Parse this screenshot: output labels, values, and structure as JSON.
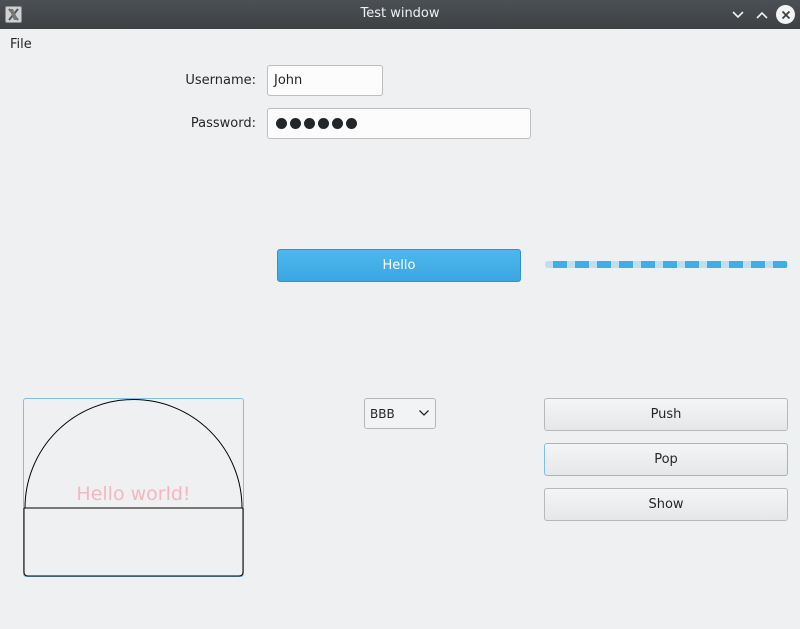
{
  "window": {
    "title": "Test window"
  },
  "menu": {
    "file": "File"
  },
  "form": {
    "username_label": "Username:",
    "username_value": "John",
    "password_label": "Password:",
    "password_mask_count": 6
  },
  "hello_button": {
    "label": "Hello"
  },
  "progress": {
    "state": "indeterminate"
  },
  "canvas": {
    "text": "Hello world!"
  },
  "combo": {
    "selected": "BBB"
  },
  "buttons": {
    "push": "Push",
    "pop": "Pop",
    "show": "Show"
  },
  "icons": {
    "app": "app-icon",
    "minimize": "chevron-down-icon",
    "maximize": "chevron-up-icon",
    "close": "close-icon",
    "combo_arrow": "chevron-down-icon"
  },
  "colors": {
    "accent": "#3daee9",
    "titlebar": "#41464a",
    "canvas_text": "#f4b7c0"
  }
}
